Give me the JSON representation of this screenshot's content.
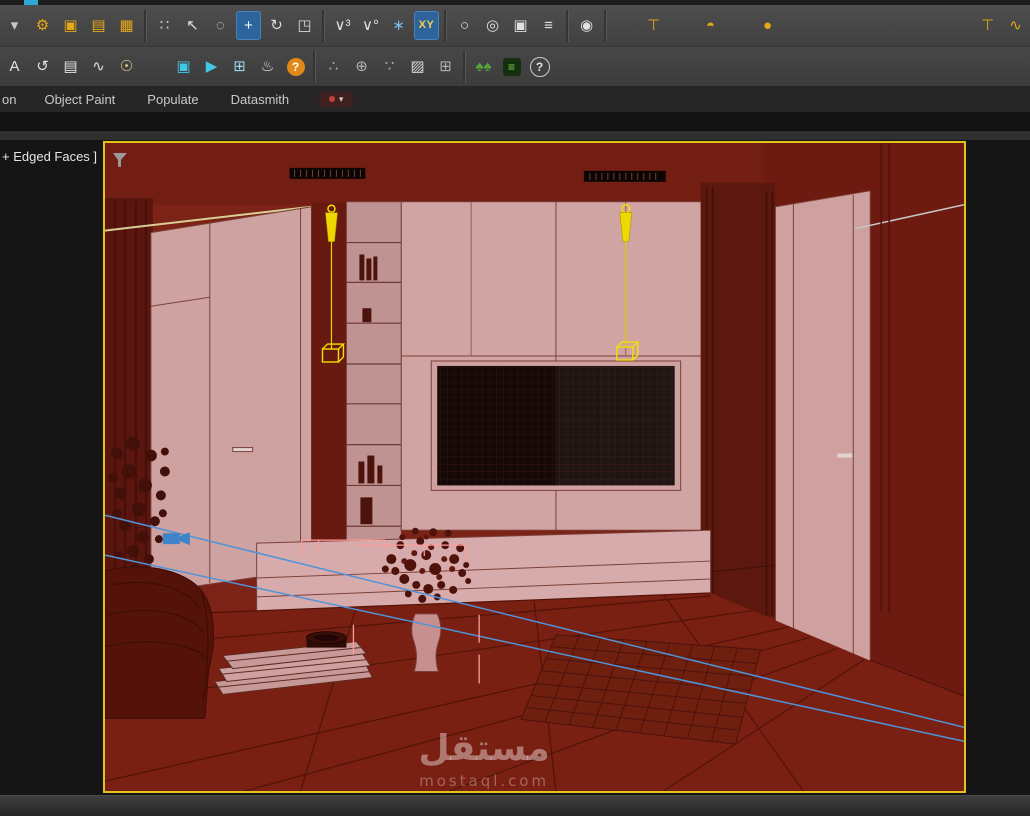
{
  "colors": {
    "toolbar_bg": "#454545",
    "ribbon_bg": "#262626",
    "viewport_border": "#e3c319",
    "active_button_blue": "#2e649c",
    "icon_yellow": "#e6a817",
    "icon_cyan": "#45c8e8",
    "icon_green": "#55a03a",
    "scene_wall": "#7c2216",
    "scene_panel": "#cfa2a2",
    "selection_yellow": "#f2e000",
    "camera_line_blue": "#4f93d8",
    "helper_pink": "#ff9c9c"
  },
  "toolbar_row1": {
    "items": [
      {
        "name": "toolbar-overflow-caret",
        "glyph": "▾",
        "color": "#c8c8c8"
      },
      {
        "name": "select-and-manipulate-icon",
        "glyph": "⚙",
        "color": "#e6a817"
      },
      {
        "name": "select-and-link-icon",
        "glyph": "▣",
        "color": "#e6a817"
      },
      {
        "name": "unlink-selection-icon",
        "glyph": "▤",
        "color": "#e6a817"
      },
      {
        "name": "bind-to-spacewarp-icon",
        "glyph": "▦",
        "color": "#e6a817"
      },
      {
        "kind": "divider",
        "name": "toolbar-divider"
      },
      {
        "name": "selection-filter-icon",
        "glyph": "∷",
        "color": "#cfcfcf"
      },
      {
        "name": "select-object-icon",
        "glyph": "↖",
        "color": "#e0e0e0"
      },
      {
        "name": "select-region-icon",
        "glyph": "◌",
        "color": "#e0e0e0"
      },
      {
        "name": "select-and-move-button",
        "glyph": "+",
        "color": "#ffffff",
        "active": true
      },
      {
        "name": "select-and-rotate-icon",
        "glyph": "↻",
        "color": "#d8d8d8"
      },
      {
        "name": "select-and-scale-icon",
        "glyph": "◳",
        "color": "#d8d8d8"
      },
      {
        "kind": "divider",
        "name": "toolbar-divider"
      },
      {
        "name": "snap-toggle-icon",
        "glyph": "∨³",
        "color": "#e0e0e0"
      },
      {
        "name": "angle-snap-icon",
        "glyph": "∨°",
        "color": "#e0e0e0"
      },
      {
        "name": "snowflake-icon",
        "glyph": "∗",
        "color": "#7ab8e8"
      },
      {
        "name": "axis-constraint-xy-button",
        "glyph": "XY",
        "color": "#f0d050",
        "active": true,
        "small": true
      },
      {
        "kind": "divider",
        "name": "toolbar-divider"
      },
      {
        "name": "select-and-place-icon",
        "glyph": "○",
        "color": "#e0e0e0"
      },
      {
        "name": "orbit-tool-icon",
        "glyph": "◎",
        "color": "#e0e0e0"
      },
      {
        "name": "render-setup-icon",
        "glyph": "▣",
        "color": "#e0e0e0"
      },
      {
        "name": "scene-list-icon",
        "glyph": "≡",
        "color": "#e0e0e0"
      },
      {
        "kind": "divider",
        "name": "toolbar-divider"
      },
      {
        "name": "camera-icon",
        "glyph": "◉",
        "color": "#e0e0e0"
      },
      {
        "kind": "divider",
        "name": "toolbar-divider"
      },
      {
        "kind": "spacer",
        "name": "toolbar-spacer"
      },
      {
        "name": "light-stand-icon",
        "glyph": "⊤",
        "color": "#e6a817"
      },
      {
        "kind": "spacer",
        "name": "toolbar-spacer"
      },
      {
        "name": "dome-light-icon",
        "glyph": "◓",
        "color": "#e6a817"
      },
      {
        "kind": "spacer",
        "name": "toolbar-spacer"
      },
      {
        "name": "sphere-light-icon",
        "glyph": "●",
        "color": "#e6a817"
      },
      {
        "kind": "spacer-flex",
        "name": "toolbar-flex-spacer"
      },
      {
        "name": "light-stand-2-icon",
        "glyph": "⊤",
        "color": "#e6a817"
      },
      {
        "name": "curve-tool-icon",
        "glyph": "∿",
        "color": "#e6a817"
      }
    ]
  },
  "toolbar_row2": {
    "items": [
      {
        "name": "letter-a-icon",
        "glyph": "A",
        "color": "#e0e0e0"
      },
      {
        "name": "spiral-icon",
        "glyph": "↺",
        "color": "#e0e0e0"
      },
      {
        "name": "layers-icon",
        "glyph": "▤",
        "color": "#e0e0e0"
      },
      {
        "name": "curve-editor-icon",
        "glyph": "∿",
        "color": "#e0e0e0"
      },
      {
        "name": "lightbulb-icon",
        "glyph": "☉",
        "color": "#e8d890"
      },
      {
        "kind": "spacer",
        "name": "toolbar-spacer"
      },
      {
        "name": "display-monitor-icon",
        "glyph": "▣",
        "color": "#45c8e8"
      },
      {
        "name": "preview-play-icon",
        "glyph": "▶",
        "color": "#45c8e8"
      },
      {
        "name": "add-box-icon",
        "glyph": "⊞",
        "color": "#9ad8e8"
      },
      {
        "name": "teapot-render-icon",
        "glyph": "♨",
        "color": "#e0e0e0"
      },
      {
        "name": "help-button",
        "glyph": "?",
        "color": "#ffffff",
        "bg": "#e08818",
        "shape": "circle"
      },
      {
        "kind": "divider",
        "name": "toolbar-divider"
      },
      {
        "name": "pivot-dots-icon",
        "glyph": "∴",
        "color": "#b0b0b0"
      },
      {
        "name": "center-crosshair-icon",
        "glyph": "⊕",
        "color": "#b0b0b0"
      },
      {
        "name": "axis-dots-icon",
        "glyph": "∵",
        "color": "#b0b0b0"
      },
      {
        "name": "checker-box-icon",
        "glyph": "▨",
        "color": "#d8d8d8"
      },
      {
        "name": "grid-add-icon",
        "glyph": "⊞",
        "color": "#b0b0b0"
      },
      {
        "kind": "divider",
        "name": "toolbar-divider"
      },
      {
        "name": "trees-icon",
        "glyph": "♠♠",
        "color": "#55a03a"
      },
      {
        "name": "itoo-list-button",
        "glyph": "≡",
        "color": "#7ad858",
        "bg": "#15300e",
        "shape": "square"
      },
      {
        "name": "help-circle-icon",
        "glyph": "?",
        "color": "#e0e0e0",
        "ring": true
      }
    ]
  },
  "ribbon": {
    "tabs": [
      {
        "name": "ribbon-tab-on",
        "label": "on"
      },
      {
        "name": "ribbon-tab-object-paint",
        "label": "Object Paint"
      },
      {
        "name": "ribbon-tab-populate",
        "label": "Populate"
      },
      {
        "name": "ribbon-tab-datasmith",
        "label": "Datasmith"
      }
    ],
    "overflow_caret": "▾"
  },
  "viewport": {
    "label": "+ Edged Faces ]",
    "watermark_title": "مستقل",
    "watermark_subtitle": "mostaql.com"
  }
}
